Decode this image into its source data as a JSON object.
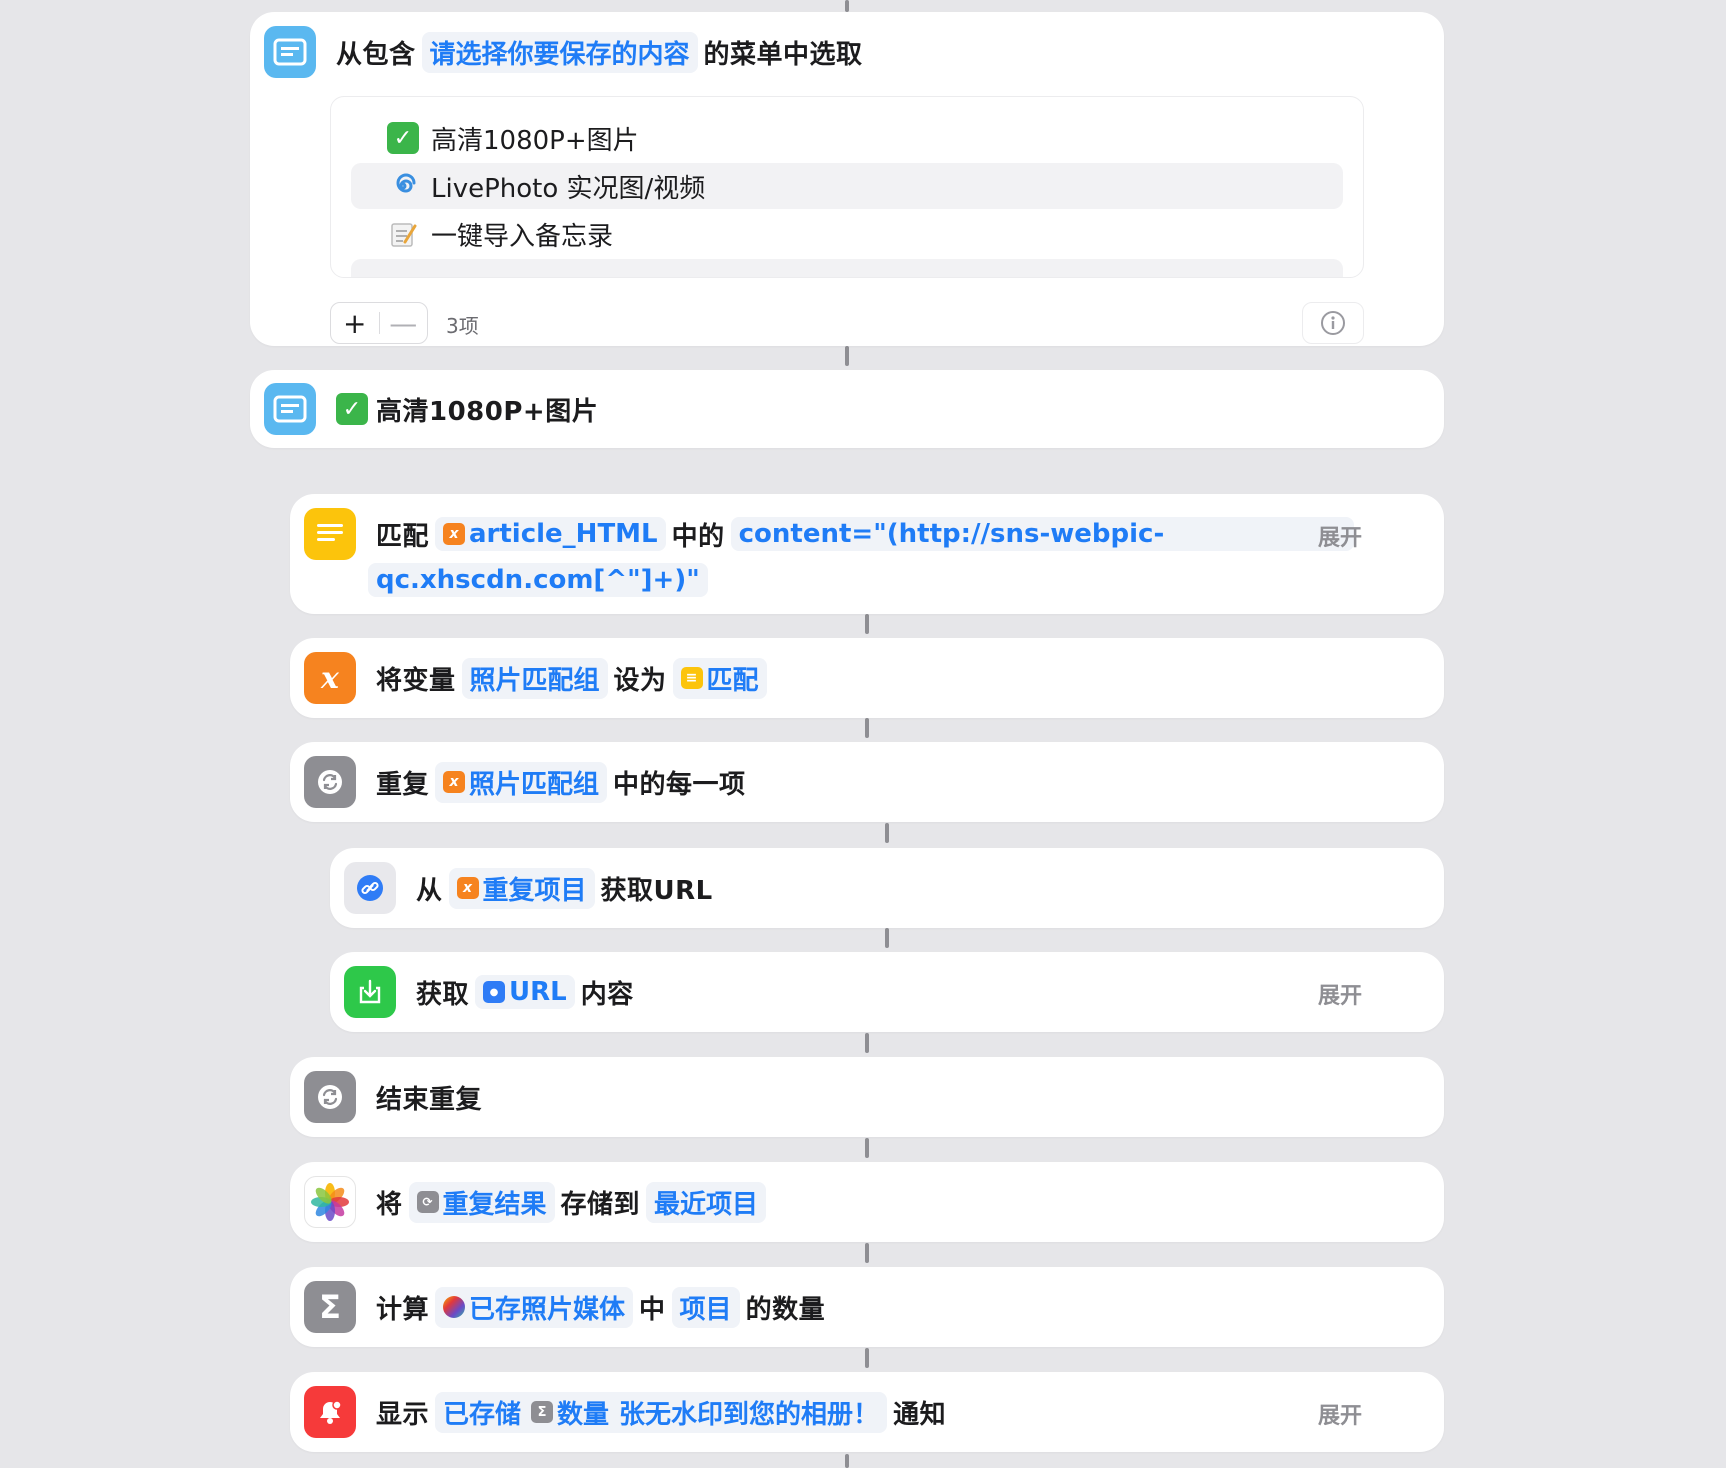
{
  "menu_action": {
    "prefix": "从包含",
    "prompt_token": "请选择你要保存的内容",
    "suffix": "的菜单中选取",
    "items": [
      {
        "icon": "check-emoji",
        "label": "高清1080P+图片"
      },
      {
        "icon": "cyclone-emoji",
        "label": "LivePhoto 实况图/视频"
      },
      {
        "icon": "memo-emoji",
        "label": "一键导入备忘录"
      }
    ],
    "count": "3项"
  },
  "menu_case": {
    "label": "高清1080P+图片"
  },
  "match": {
    "prefix": "匹配",
    "var_token": "article_HTML",
    "middle": "中的",
    "pattern_line1": "content=\"(http://sns-webpic-",
    "pattern_line2": "qc.xhscdn.com[^\"]+)\"",
    "expand": "展开"
  },
  "set_var": {
    "prefix": "将变量",
    "name_token": "照片匹配组",
    "middle": "设为",
    "value_token": "匹配"
  },
  "repeat": {
    "prefix": "重复",
    "token": "照片匹配组",
    "suffix": "中的每一项"
  },
  "get_url": {
    "prefix": "从",
    "token": "重复项目",
    "suffix": "获取URL"
  },
  "get_contents": {
    "prefix": "获取",
    "token": "URL",
    "suffix": "内容",
    "expand": "展开"
  },
  "end_repeat": {
    "label": "结束重复"
  },
  "save": {
    "prefix": "将",
    "token": "重复结果",
    "middle": "存储到",
    "album_token": "最近项目"
  },
  "count_action": {
    "prefix": "计算",
    "token": "已存照片媒体",
    "middle": "中",
    "item_token": "项目",
    "suffix": "的数量"
  },
  "notify": {
    "prefix": "显示",
    "token_a": "已存储",
    "token_b": "数量",
    "token_c": "张无水印到您的相册！",
    "suffix": "通知",
    "expand": "展开"
  },
  "colors": {
    "accent": "#1f7cf6",
    "orange": "#f6831f",
    "yellow": "#fcc40c",
    "green": "#2ec84a",
    "red": "#f63a3a",
    "gray": "#8e8e93",
    "menu_blue": "#5ab8f0"
  }
}
